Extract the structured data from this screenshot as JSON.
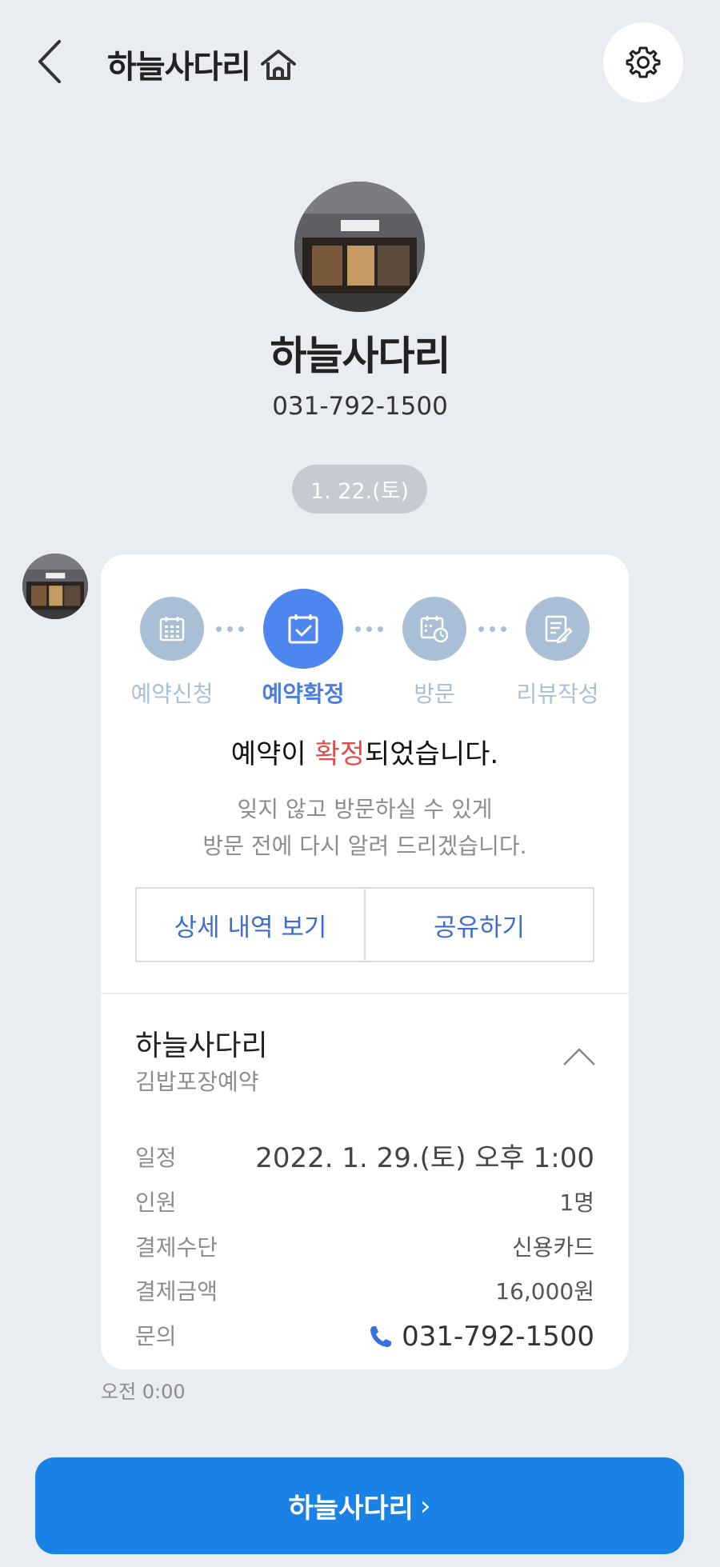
{
  "header": {
    "title": "하늘사다리"
  },
  "profile": {
    "name": "하늘사다리",
    "phone": "031-792-1500"
  },
  "date_chip": "1. 22.(토)",
  "card": {
    "steps": [
      {
        "label": "예약신청",
        "icon": "calendar-grid-icon",
        "active": false
      },
      {
        "label": "예약확정",
        "icon": "calendar-check-icon",
        "active": true
      },
      {
        "label": "방문",
        "icon": "calendar-clock-icon",
        "active": false
      },
      {
        "label": "리뷰작성",
        "icon": "edit-note-icon",
        "active": false
      }
    ],
    "title_prefix": "예약이 ",
    "title_highlight": "확정",
    "title_suffix": "되었습니다.",
    "desc_line1": "잊지 않고 방문하실 수 있게",
    "desc_line2": "방문 전에 다시 알려 드리겠습니다.",
    "btn_detail": "상세 내역 보기",
    "btn_share": "공유하기",
    "shop_name": "하늘사다리",
    "shop_sub": "김밥포장예약",
    "rows": [
      {
        "label": "일정",
        "value": "2022. 1. 29.(토) 오후 1:00"
      },
      {
        "label": "인원",
        "value": "1명"
      },
      {
        "label": "결제수단",
        "value": "신용카드"
      },
      {
        "label": "결제금액",
        "value": "16,000원"
      },
      {
        "label": "문의",
        "value": "031-792-1500"
      }
    ]
  },
  "timestamp": "오전 0:00",
  "bottom_button": "하늘사다리",
  "colors": {
    "background": "#e9ecf1",
    "accent_blue": "#1a82e6",
    "step_active": "#4e86ef",
    "step_inactive": "#a9bfd5",
    "highlight_red": "#e04d4d"
  }
}
